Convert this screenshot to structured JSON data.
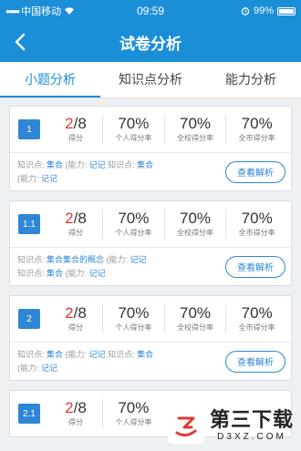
{
  "status": {
    "carrier": "中国移动",
    "time": "09:59",
    "battery": "99%"
  },
  "nav": {
    "title": "试卷分析"
  },
  "tabs": [
    {
      "label": "小题分析",
      "active": true
    },
    {
      "label": "知识点分析",
      "active": false
    },
    {
      "label": "能力分析",
      "active": false
    }
  ],
  "cards": [
    {
      "num": "1",
      "score_got": "2",
      "score_total": "/8",
      "score_label": "得分",
      "stats": [
        {
          "value": "70%",
          "label": "个人得分率"
        },
        {
          "value": "70%",
          "label": "全校得分率"
        },
        {
          "value": "70%",
          "label": "全市得分率"
        }
      ],
      "line1": {
        "k1": "知识点:",
        "v1": "集合",
        "k2": "(能力:",
        "v2": "记记",
        "k3": "知识点:",
        "v3": "集合"
      },
      "line2": {
        "k1": "(能力:",
        "v1": "记记"
      },
      "button": "查看解析"
    },
    {
      "num": "1.1",
      "score_got": "2",
      "score_total": "/8",
      "score_label": "得分",
      "stats": [
        {
          "value": "70%",
          "label": "个人得分率"
        },
        {
          "value": "70%",
          "label": "全校得分率"
        },
        {
          "value": "70%",
          "label": "全市得分率"
        }
      ],
      "line1": {
        "k1": "知识点:",
        "v1": "集合集合的概念",
        "k2": "(能力:",
        "v2": "记记"
      },
      "line2": {
        "k1": "知识点:",
        "v1": "集合",
        "k2": "(能力:",
        "v2": "记记"
      },
      "button": "查看解析"
    },
    {
      "num": "2",
      "score_got": "2",
      "score_total": "/8",
      "score_label": "得分",
      "stats": [
        {
          "value": "70%",
          "label": "个人得分率"
        },
        {
          "value": "70%",
          "label": "全校得分率"
        },
        {
          "value": "70%",
          "label": "全市得分率"
        }
      ],
      "line1": {
        "k1": "知识点:",
        "v1": "集合",
        "k2": "(能力:",
        "v2": "记记",
        "k3": "知识点:",
        "v3": "集合"
      },
      "line2": {
        "k1": "(能力:",
        "v1": "记记"
      },
      "button": "查看解析"
    },
    {
      "num": "2.1",
      "score_got": "2",
      "score_total": "/8",
      "score_label": "得分",
      "stats": [
        {
          "value": "70%",
          "label": "个人得分率"
        }
      ]
    }
  ],
  "watermark": {
    "main": "第三下载",
    "sub": "D3XZ.COM"
  },
  "colors": {
    "primary": "#1b8ed8",
    "accent": "#2f86d4",
    "score_red": "#e03a2f"
  },
  "icons": {
    "back": "back-arrow-icon",
    "wifi": "wifi-icon",
    "alarm": "alarm-icon",
    "battery": "battery-icon"
  }
}
